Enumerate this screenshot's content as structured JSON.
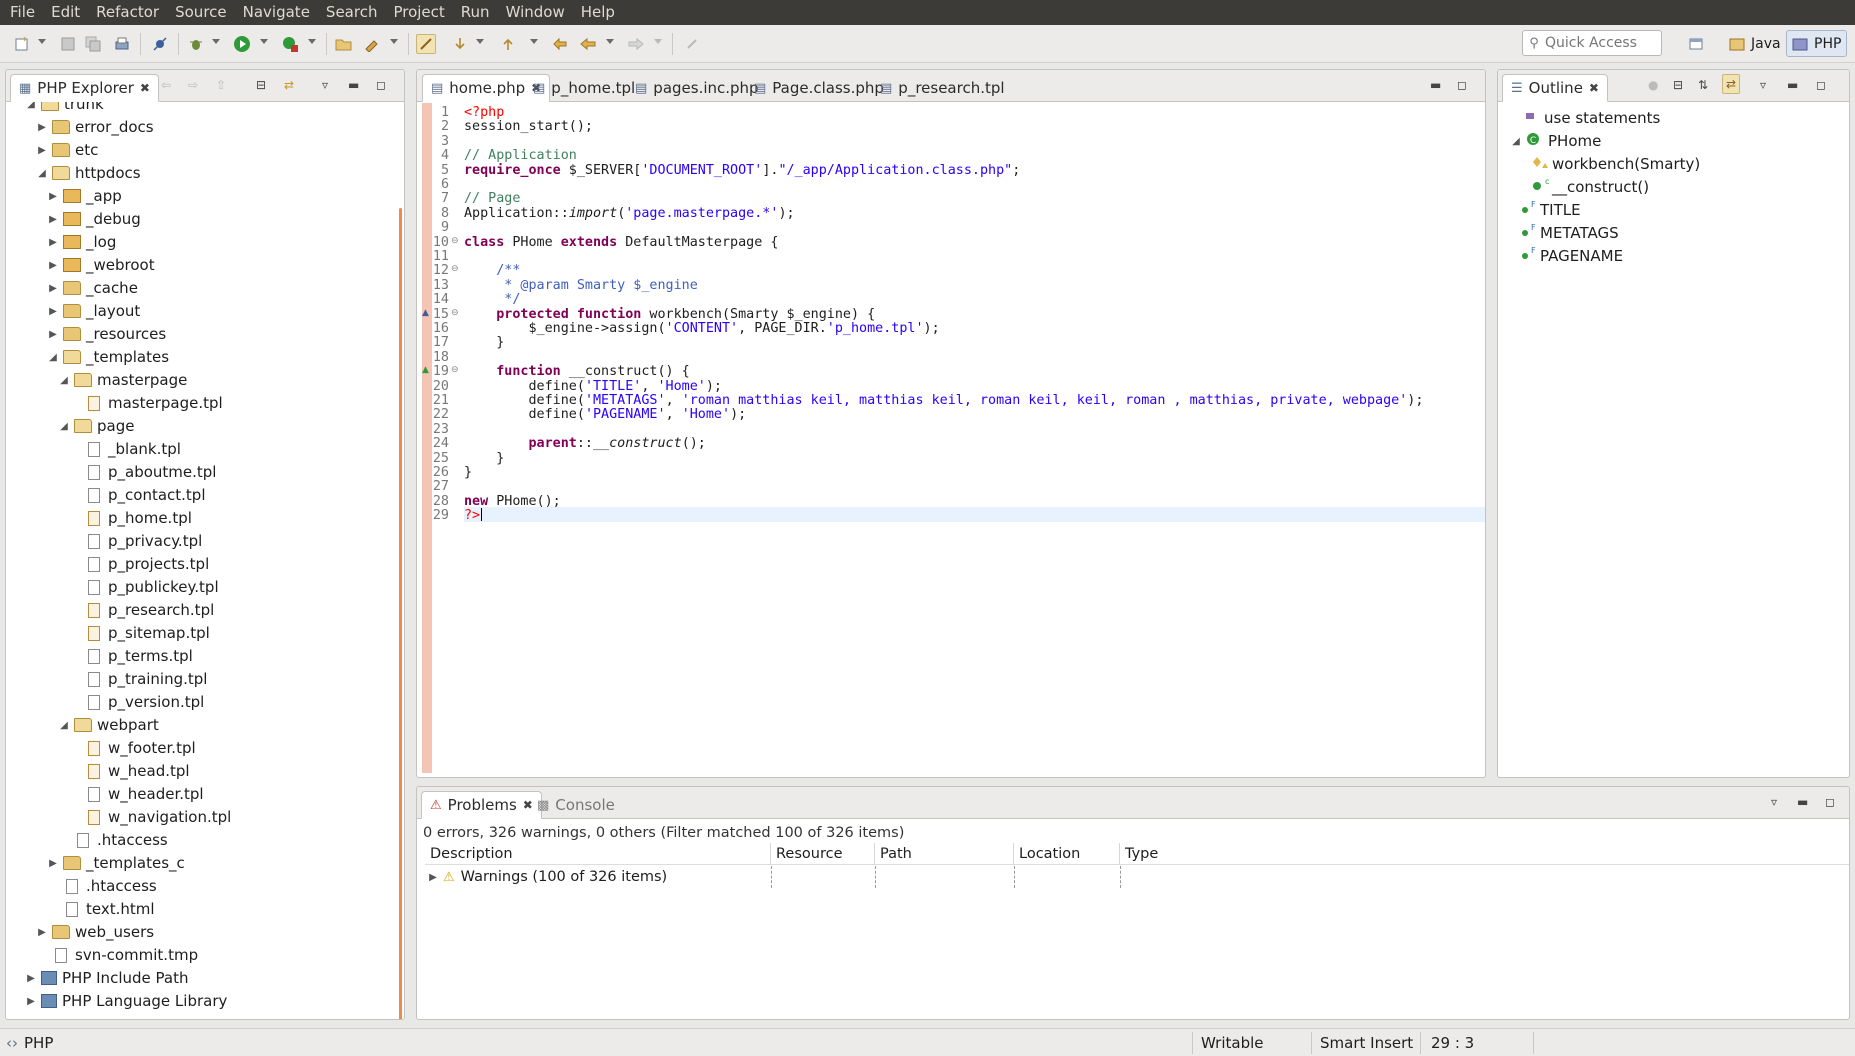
{
  "menu": [
    "File",
    "Edit",
    "Refactor",
    "Source",
    "Navigate",
    "Search",
    "Project",
    "Run",
    "Window",
    "Help"
  ],
  "toolbar": {
    "quick_access_placeholder": "Quick Access",
    "perspective_java": "Java",
    "perspective_php": "PHP"
  },
  "explorer": {
    "title": "PHP Explorer",
    "tree": [
      {
        "label": "trunk",
        "depth": 1,
        "type": "folder-open",
        "twisty": "open"
      },
      {
        "label": "error_docs",
        "depth": 2,
        "type": "folder",
        "twisty": "closed"
      },
      {
        "label": "etc",
        "depth": 2,
        "type": "folder",
        "twisty": "closed"
      },
      {
        "label": "httpdocs",
        "depth": 2,
        "type": "folder-open",
        "twisty": "open"
      },
      {
        "label": "_app",
        "depth": 3,
        "type": "package",
        "twisty": "closed"
      },
      {
        "label": "_debug",
        "depth": 3,
        "type": "package",
        "twisty": "closed"
      },
      {
        "label": "_log",
        "depth": 3,
        "type": "package",
        "twisty": "closed"
      },
      {
        "label": "_webroot",
        "depth": 3,
        "type": "package",
        "twisty": "closed"
      },
      {
        "label": "_cache",
        "depth": 3,
        "type": "folder",
        "twisty": "closed"
      },
      {
        "label": "_layout",
        "depth": 3,
        "type": "folder",
        "twisty": "closed"
      },
      {
        "label": "_resources",
        "depth": 3,
        "type": "folder",
        "twisty": "closed"
      },
      {
        "label": "_templates",
        "depth": 3,
        "type": "folder-open",
        "twisty": "open"
      },
      {
        "label": "masterpage",
        "depth": 4,
        "type": "folder-open",
        "twisty": "open"
      },
      {
        "label": "masterpage.tpl",
        "depth": 5,
        "type": "tpl",
        "twisty": ""
      },
      {
        "label": "page",
        "depth": 4,
        "type": "folder-open",
        "twisty": "open"
      },
      {
        "label": "_blank.tpl",
        "depth": 5,
        "type": "file",
        "twisty": ""
      },
      {
        "label": "p_aboutme.tpl",
        "depth": 5,
        "type": "file",
        "twisty": ""
      },
      {
        "label": "p_contact.tpl",
        "depth": 5,
        "type": "file",
        "twisty": ""
      },
      {
        "label": "p_home.tpl",
        "depth": 5,
        "type": "tpl",
        "twisty": ""
      },
      {
        "label": "p_privacy.tpl",
        "depth": 5,
        "type": "file",
        "twisty": ""
      },
      {
        "label": "p_projects.tpl",
        "depth": 5,
        "type": "file",
        "twisty": ""
      },
      {
        "label": "p_publickey.tpl",
        "depth": 5,
        "type": "file",
        "twisty": ""
      },
      {
        "label": "p_research.tpl",
        "depth": 5,
        "type": "tpl",
        "twisty": ""
      },
      {
        "label": "p_sitemap.tpl",
        "depth": 5,
        "type": "tpl",
        "twisty": ""
      },
      {
        "label": "p_terms.tpl",
        "depth": 5,
        "type": "file",
        "twisty": ""
      },
      {
        "label": "p_training.tpl",
        "depth": 5,
        "type": "file",
        "twisty": ""
      },
      {
        "label": "p_version.tpl",
        "depth": 5,
        "type": "file",
        "twisty": ""
      },
      {
        "label": "webpart",
        "depth": 4,
        "type": "folder-open",
        "twisty": "open"
      },
      {
        "label": "w_footer.tpl",
        "depth": 5,
        "type": "tpl",
        "twisty": ""
      },
      {
        "label": "w_head.tpl",
        "depth": 5,
        "type": "tpl",
        "twisty": ""
      },
      {
        "label": "w_header.tpl",
        "depth": 5,
        "type": "file",
        "twisty": ""
      },
      {
        "label": "w_navigation.tpl",
        "depth": 5,
        "type": "tpl",
        "twisty": ""
      },
      {
        "label": ".htaccess",
        "depth": 4,
        "type": "file",
        "twisty": ""
      },
      {
        "label": "_templates_c",
        "depth": 3,
        "type": "folder",
        "twisty": "closed"
      },
      {
        "label": ".htaccess",
        "depth": 3,
        "type": "file",
        "twisty": ""
      },
      {
        "label": "text.html",
        "depth": 3,
        "type": "file",
        "twisty": ""
      },
      {
        "label": "web_users",
        "depth": 2,
        "type": "folder",
        "twisty": "closed"
      },
      {
        "label": "svn-commit.tmp",
        "depth": 2,
        "type": "file",
        "twisty": ""
      },
      {
        "label": "PHP Include Path",
        "depth": 1,
        "type": "library",
        "twisty": "closed"
      },
      {
        "label": "PHP Language Library",
        "depth": 1,
        "type": "library",
        "twisty": "closed"
      }
    ]
  },
  "editor": {
    "tabs": [
      "home.php",
      "p_home.tpl",
      "pages.inc.php",
      "Page.class.php",
      "p_research.tpl"
    ],
    "active_tab": "home.php",
    "lines": [
      [
        [
          "php",
          "<?php"
        ]
      ],
      [
        [
          "",
          "session_start();"
        ]
      ],
      [
        [
          "",
          ""
        ]
      ],
      [
        [
          "cm",
          "// Application"
        ]
      ],
      [
        [
          "kw",
          "require_once"
        ],
        [
          "",
          " $_SERVER["
        ],
        [
          "str",
          "'DOCUMENT_ROOT'"
        ],
        [
          "",
          "]."
        ],
        [
          "str",
          "\"/_app/Application.class.php\""
        ],
        [
          "",
          ";"
        ]
      ],
      [
        [
          "",
          ""
        ]
      ],
      [
        [
          "cm",
          "// Page"
        ]
      ],
      [
        [
          "",
          "Application::"
        ],
        [
          "it",
          "import"
        ],
        [
          "",
          "("
        ],
        [
          "str",
          "'page.masterpage.*'"
        ],
        [
          "",
          ");"
        ]
      ],
      [
        [
          "",
          ""
        ]
      ],
      [
        [
          "kw",
          "class"
        ],
        [
          "",
          " PHome "
        ],
        [
          "kw",
          "extends"
        ],
        [
          "",
          " DefaultMasterpage {"
        ]
      ],
      [
        [
          "",
          ""
        ]
      ],
      [
        [
          "doc",
          "    /**"
        ]
      ],
      [
        [
          "doc",
          "     * @param Smarty $_engine"
        ]
      ],
      [
        [
          "doc",
          "     */"
        ]
      ],
      [
        [
          "",
          "    "
        ],
        [
          "kw",
          "protected function"
        ],
        [
          "",
          " workbench(Smarty $_engine) {"
        ]
      ],
      [
        [
          "",
          "        $_engine->assign("
        ],
        [
          "str",
          "'CONTENT'"
        ],
        [
          "",
          ", PAGE_DIR."
        ],
        [
          "str",
          "'p_home.tpl'"
        ],
        [
          "",
          ");"
        ]
      ],
      [
        [
          "",
          "    }"
        ]
      ],
      [
        [
          "",
          ""
        ]
      ],
      [
        [
          "",
          "    "
        ],
        [
          "kw",
          "function"
        ],
        [
          "",
          " __construct() {"
        ]
      ],
      [
        [
          "",
          "        define("
        ],
        [
          "str",
          "'TITLE'"
        ],
        [
          "",
          ", "
        ],
        [
          "str",
          "'Home'"
        ],
        [
          "",
          ");"
        ]
      ],
      [
        [
          "",
          "        define("
        ],
        [
          "str",
          "'METATAGS'"
        ],
        [
          "",
          ", "
        ],
        [
          "str",
          "'roman matthias keil, matthias keil, roman keil, keil, roman , matthias, private, webpage'"
        ],
        [
          "",
          ");"
        ]
      ],
      [
        [
          "",
          "        define("
        ],
        [
          "str",
          "'PAGENAME'"
        ],
        [
          "",
          ", "
        ],
        [
          "str",
          "'Home'"
        ],
        [
          "",
          ");"
        ]
      ],
      [
        [
          "",
          ""
        ]
      ],
      [
        [
          "",
          "        "
        ],
        [
          "kw",
          "parent"
        ],
        [
          "",
          "::"
        ],
        [
          "it",
          "__construct"
        ],
        [
          "",
          "();"
        ]
      ],
      [
        [
          "",
          "    }"
        ]
      ],
      [
        [
          "",
          "}"
        ]
      ],
      [
        [
          "",
          ""
        ]
      ],
      [
        [
          "kw",
          "new"
        ],
        [
          "",
          " PHome();"
        ]
      ],
      [
        [
          "php",
          "?>"
        ]
      ]
    ]
  },
  "outline": {
    "title": "Outline",
    "items": [
      {
        "label": "use statements",
        "depth": 0,
        "kind": "use"
      },
      {
        "label": "PHome",
        "depth": 0,
        "kind": "class"
      },
      {
        "label": "workbench(Smarty)",
        "depth": 1,
        "kind": "protected-method"
      },
      {
        "label": "__construct()",
        "depth": 1,
        "kind": "constructor"
      },
      {
        "label": "TITLE",
        "depth": 0,
        "kind": "constant"
      },
      {
        "label": "METATAGS",
        "depth": 0,
        "kind": "constant"
      },
      {
        "label": "PAGENAME",
        "depth": 0,
        "kind": "constant"
      }
    ]
  },
  "problems": {
    "tab_problems": "Problems",
    "tab_console": "Console",
    "summary": "0 errors, 326 warnings, 0 others (Filter matched 100 of 326 items)",
    "columns": [
      "Description",
      "Resource",
      "Path",
      "Location",
      "Type"
    ],
    "warnings_row": "Warnings (100 of 326 items)"
  },
  "statusbar": {
    "left": "PHP",
    "writable": "Writable",
    "insert_mode": "Smart Insert",
    "position": "29 : 3"
  },
  "colors": {
    "menubar": "#3c3b37",
    "keyword": "#7f0055",
    "string": "#2a00ff",
    "comment": "#3f7f5f",
    "doc": "#3f5fbf",
    "php_tag": "#ff0000",
    "scroll_marker": "#f08a4b"
  }
}
